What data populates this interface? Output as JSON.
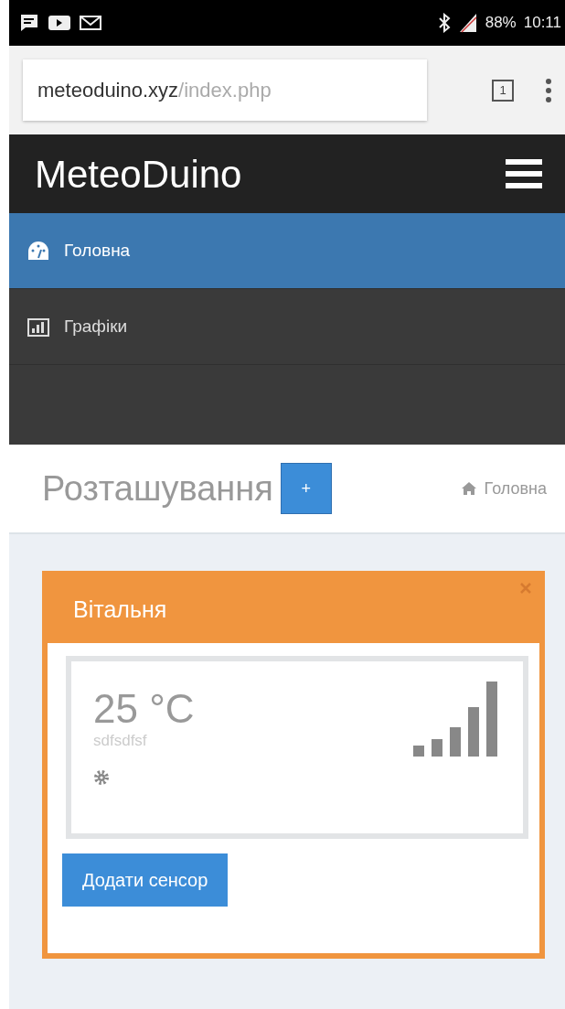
{
  "status_bar": {
    "battery": "88%",
    "time": "10:11"
  },
  "browser": {
    "url_host": "meteoduino.xyz",
    "url_path": "/index.php",
    "tab_count": "1"
  },
  "navbar": {
    "brand": "MeteoDuino"
  },
  "menu": [
    {
      "label": "Головна",
      "kind": "dashboard",
      "selected": true
    },
    {
      "label": "Графіки",
      "kind": "chart",
      "selected": false
    }
  ],
  "page_header": {
    "title": "Розташування",
    "add_button": "+",
    "breadcrumb": "Головна"
  },
  "rooms": [
    {
      "title": "Вітальня",
      "sensors": [
        {
          "reading": "25 °C",
          "name": "sdfsdfsf"
        }
      ],
      "add_button": "Додати сенсор"
    }
  ]
}
